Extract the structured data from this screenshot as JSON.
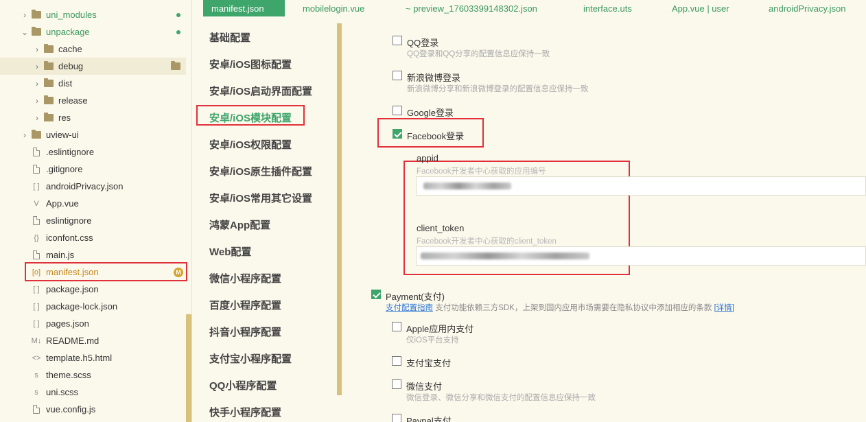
{
  "explorer": {
    "rows": [
      {
        "label": "uni_modules",
        "type": "folder",
        "indent": 0,
        "chev": "›",
        "color": "green",
        "dot": true
      },
      {
        "label": "unpackage",
        "type": "folder",
        "indent": 0,
        "chev": "⌄",
        "color": "green",
        "dot": true
      },
      {
        "label": "cache",
        "type": "folder",
        "indent": 1,
        "chev": "›"
      },
      {
        "label": "debug",
        "type": "folder",
        "indent": 1,
        "chev": "›",
        "highlight": true,
        "right_folder": true
      },
      {
        "label": "dist",
        "type": "folder",
        "indent": 1,
        "chev": "›"
      },
      {
        "label": "release",
        "type": "folder",
        "indent": 1,
        "chev": "›"
      },
      {
        "label": "res",
        "type": "folder",
        "indent": 1,
        "chev": "›"
      },
      {
        "label": "uview-ui",
        "type": "folder",
        "indent": 0,
        "chev": "›"
      },
      {
        "label": ".eslintignore",
        "type": "file",
        "icon": "file"
      },
      {
        "label": ".gitignore",
        "type": "file",
        "icon": "file"
      },
      {
        "label": "androidPrivacy.json",
        "type": "file",
        "icon": "[ ]"
      },
      {
        "label": "App.vue",
        "type": "file",
        "icon": "V"
      },
      {
        "label": "eslintignore",
        "type": "file",
        "icon": "file"
      },
      {
        "label": "iconfont.css",
        "type": "file",
        "icon": "{}"
      },
      {
        "label": "main.js",
        "type": "file",
        "icon": "file"
      },
      {
        "label": "manifest.json",
        "type": "file",
        "icon": "[o]",
        "color": "orange",
        "badge": "M"
      },
      {
        "label": "package.json",
        "type": "file",
        "icon": "[ ]"
      },
      {
        "label": "package-lock.json",
        "type": "file",
        "icon": "[ ]"
      },
      {
        "label": "pages.json",
        "type": "file",
        "icon": "[ ]"
      },
      {
        "label": "README.md",
        "type": "file",
        "icon": "M↓"
      },
      {
        "label": "template.h5.html",
        "type": "file",
        "icon": "<>"
      },
      {
        "label": "theme.scss",
        "type": "file",
        "icon": "s"
      },
      {
        "label": "uni.scss",
        "type": "file",
        "icon": "s"
      },
      {
        "label": "vue.config.js",
        "type": "file",
        "icon": "file"
      }
    ]
  },
  "tabs": [
    {
      "label": "manifest.json",
      "active": true
    },
    {
      "label": "mobilelogin.vue"
    },
    {
      "label": "~ preview_17603399148302.json"
    },
    {
      "label": "interface.uts"
    },
    {
      "label": "App.vue | user"
    },
    {
      "label": "androidPrivacy.json"
    }
  ],
  "settings_nav": [
    "基础配置",
    "安卓/iOS图标配置",
    "安卓/iOS启动界面配置",
    "安卓/iOS模块配置",
    "安卓/iOS权限配置",
    "安卓/iOS原生插件配置",
    "安卓/iOS常用其它设置",
    "鸿蒙App配置",
    "Web配置",
    "微信小程序配置",
    "百度小程序配置",
    "抖音小程序配置",
    "支付宝小程序配置",
    "QQ小程序配置",
    "快手小程序配置"
  ],
  "settings_nav_active": "安卓/iOS模块配置",
  "content": {
    "qq": {
      "title": "QQ登录",
      "desc": "QQ登录和QQ分享的配置信息应保持一致",
      "checked": false
    },
    "weibo": {
      "title": "新浪微博登录",
      "desc": "新浪微博分享和新浪微博登录的配置信息应保持一致",
      "checked": false
    },
    "google": {
      "title": "Google登录",
      "checked": false
    },
    "facebook": {
      "title": "Facebook登录",
      "checked": true
    },
    "appid": {
      "label": "appid",
      "desc": "Facebook开发者中心获取的应用编号"
    },
    "client_token": {
      "label": "client_token",
      "desc": "Facebook开发者中心获取的client_token"
    },
    "payment": {
      "title": "Payment(支付)",
      "checked": true,
      "guide_link": "支付配置指南",
      "note": "支付功能依赖三方SDK，上架到国内应用市场需要在隐私协议中添加相应的条款",
      "detail_link": "[详情]"
    },
    "apple_pay": {
      "title": "Apple应用内支付",
      "desc": "仅iOS平台支持",
      "checked": false
    },
    "alipay": {
      "title": "支付宝支付",
      "checked": false
    },
    "wechat_pay": {
      "title": "微信支付",
      "desc": "微信登录、微信分享和微信支付的配置信息应保持一致",
      "checked": false
    },
    "paypal": {
      "title": "Paypal支付",
      "checked": false
    }
  },
  "colors": {
    "accent": "#3ea56b",
    "highlight_box": "#e0303a",
    "link": "#2a73d4"
  }
}
